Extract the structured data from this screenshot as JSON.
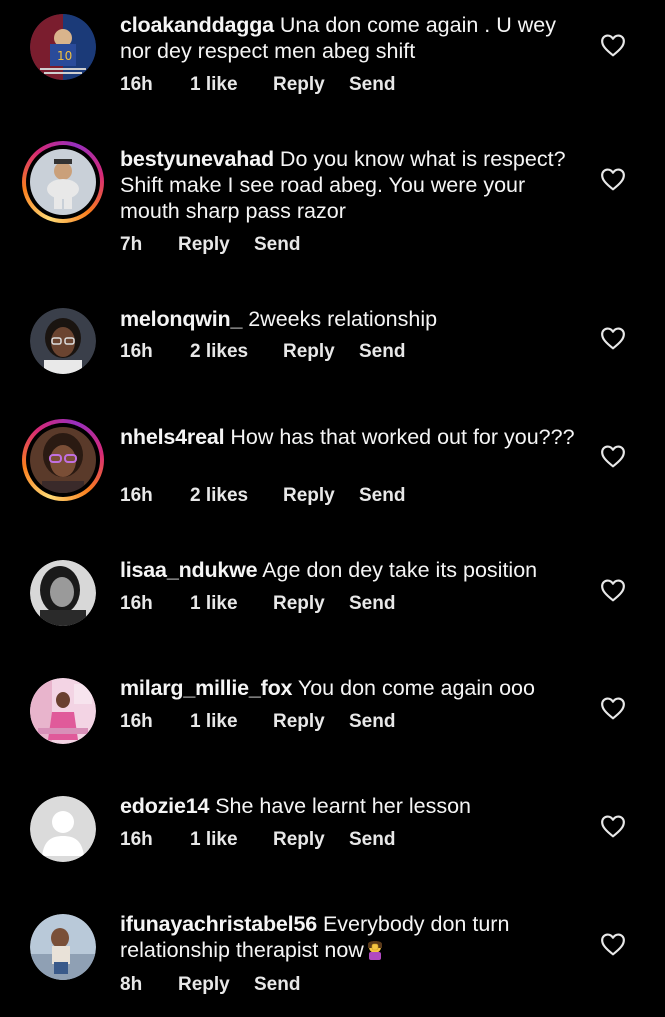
{
  "comments": [
    {
      "username": "cloakanddagga",
      "text": "Una don come again . U wey nor dey respect men abeg shift",
      "time": "16h",
      "likes": "1 like",
      "reply_label": "Reply",
      "send_label": "Send"
    },
    {
      "username": "bestyunevahad",
      "text": "Do you know what is respect? Shift make I see road abeg. You were your mouth sharp pass razor",
      "time": "7h",
      "likes": "",
      "reply_label": "Reply",
      "send_label": "Send"
    },
    {
      "username": "melonqwin_",
      "text": "2weeks relationship",
      "time": "16h",
      "likes": "2 likes",
      "reply_label": "Reply",
      "send_label": "Send"
    },
    {
      "username": "nhels4real",
      "text": "How has that worked out for you???",
      "time": "16h",
      "likes": "2 likes",
      "reply_label": "Reply",
      "send_label": "Send"
    },
    {
      "username": "lisaa_ndukwe",
      "text": "Age don dey take its position",
      "time": "16h",
      "likes": "1 like",
      "reply_label": "Reply",
      "send_label": "Send"
    },
    {
      "username": "milarg_millie_fox",
      "text": "You don come again ooo",
      "time": "16h",
      "likes": "1 like",
      "reply_label": "Reply",
      "send_label": "Send"
    },
    {
      "username": "edozie14",
      "text": "She have learnt her lesson",
      "time": "16h",
      "likes": "1 like",
      "reply_label": "Reply",
      "send_label": "Send"
    },
    {
      "username": "ifunayachristabel56",
      "text": "Everybody don turn relationship therapist now",
      "emoji": "woman-facepalming-emoji",
      "time": "8h",
      "likes": "",
      "reply_label": "Reply",
      "send_label": "Send"
    }
  ],
  "colors": {
    "background": "#000000",
    "text": "#f5f5f5",
    "heart_outline": "#e8e8e8"
  }
}
